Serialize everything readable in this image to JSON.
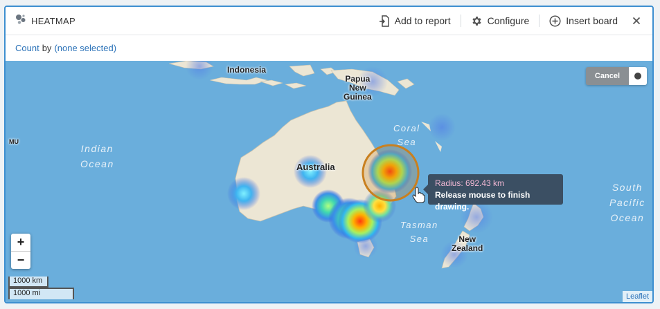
{
  "header": {
    "title": "HEATMAP",
    "title_icon": "heatmap-icon",
    "add_to_report_label": "Add to report",
    "configure_label": "Configure",
    "insert_board_label": "Insert board"
  },
  "subbar": {
    "metric": "Count",
    "by_text": "by",
    "group": "(none selected)"
  },
  "map": {
    "labels": {
      "indonesia": "Indonesia",
      "papua_line1": "Papua",
      "papua_line2": "New",
      "papua_line3": "Guinea",
      "australia": "Australia",
      "new_zealand_line1": "New",
      "new_zealand_line2": "Zealand",
      "mu": "MU"
    },
    "seas": {
      "indian_line1": "Indian",
      "indian_line2": "Ocean",
      "coral_line1": "Coral",
      "coral_line2": "Sea",
      "tasman_line1": "Tasman",
      "tasman_line2": "Sea",
      "south_pacific_line1": "South",
      "south_pacific_line2": "Pacific",
      "south_pacific_line3": "Ocean"
    },
    "zoom_in": "+",
    "zoom_out": "−",
    "scale_km": "1000 km",
    "scale_mi": "1000 mi",
    "attribution": "Leaflet",
    "cancel_label": "Cancel",
    "tooltip": {
      "radius_text": "Radius: 692.43 km",
      "hint_text": "Release mouse to finish drawing."
    }
  },
  "colors": {
    "accent": "#3d8fd0",
    "link": "#2b72b8",
    "sea": "#6aaedc",
    "land": "#ece6d4",
    "draw_circle": "#c9801f"
  }
}
